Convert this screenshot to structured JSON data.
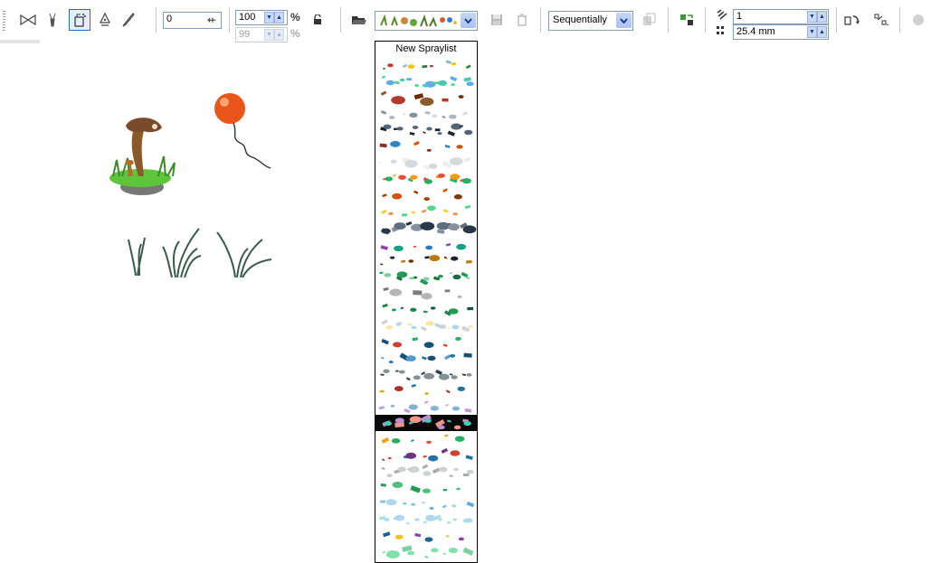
{
  "toolbar": {
    "icons": {
      "preset": "bowtie-icon",
      "brush": "brush-icon",
      "sprayer": "sprayer-icon",
      "calligraphic": "pen-nib-icon",
      "pressure": "pressure-pen-icon",
      "open": "folder-open-icon",
      "save": "save-icon",
      "delete": "trash-icon",
      "playlist": "playlist-icon",
      "reset": "reset-icon",
      "rotation": "rotation-icon",
      "offset": "offset-icon",
      "lock": "lock-icon"
    },
    "smoothing_value": "0",
    "size_value": "100",
    "size_unit": "%",
    "size2_value": "99",
    "size2_unit": "%",
    "spray_order": "Sequentially",
    "dabs_value": "1",
    "spacing_value": "25.4 mm"
  },
  "spraylist": {
    "header": "New Spraylist",
    "stroke_count": 32,
    "selected_index": 22
  },
  "colors": {
    "accent": "#316ac5",
    "combo_border": "#7f9db9",
    "balloon": "#e8561a"
  }
}
